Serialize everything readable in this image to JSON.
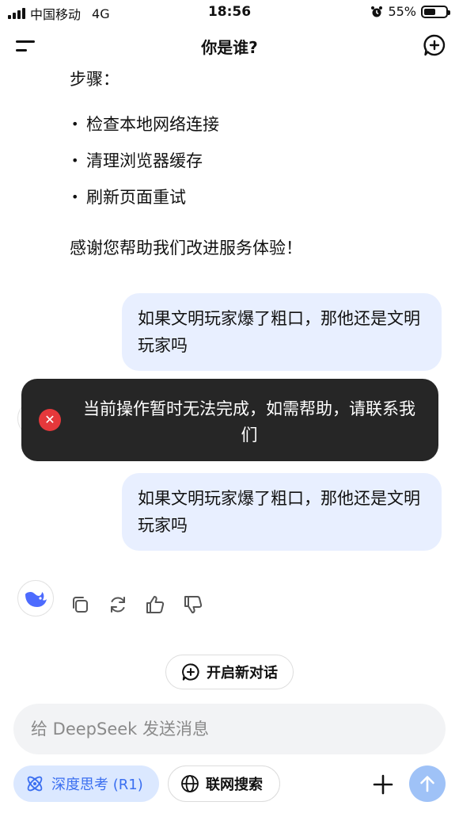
{
  "status_bar": {
    "carrier": "中国移动",
    "network": "4G",
    "time": "18:56",
    "battery": "55%",
    "battery_level": 0.55
  },
  "header": {
    "title": "你是谁?",
    "menu_icon": "hamburger-icon",
    "new_chat_icon": "new-chat-icon"
  },
  "assistant_message": {
    "steps_title": "步骤：",
    "steps": [
      "检查本地网络连接",
      "清理浏览器缓存",
      "刷新页面重试"
    ],
    "thanks": "感谢您帮助我们改进服务体验！"
  },
  "user_messages": [
    {
      "text": "如果文明玩家爆了粗口，那他还是文明玩家吗"
    },
    {
      "text": "如果文明玩家爆了粗口，那他还是文明玩家吗"
    }
  ],
  "toast": {
    "text": "当前操作暂时无法完成，如需帮助，请联系我们",
    "icon": "error-icon",
    "icon_color": "#e5383b"
  },
  "actions": {
    "icons": [
      "copy-icon",
      "regenerate-icon",
      "thumbs-up-icon",
      "thumbs-down-icon"
    ]
  },
  "new_dialog": {
    "label": "开启新对话"
  },
  "composer": {
    "placeholder": "给 DeepSeek 发送消息",
    "deepthink_label": "深度思考 (R1)",
    "websearch_label": "联网搜索"
  },
  "colors": {
    "accent": "#3b6ff0",
    "user_bubble": "#e8efff",
    "send_button": "#9fc2f7"
  }
}
